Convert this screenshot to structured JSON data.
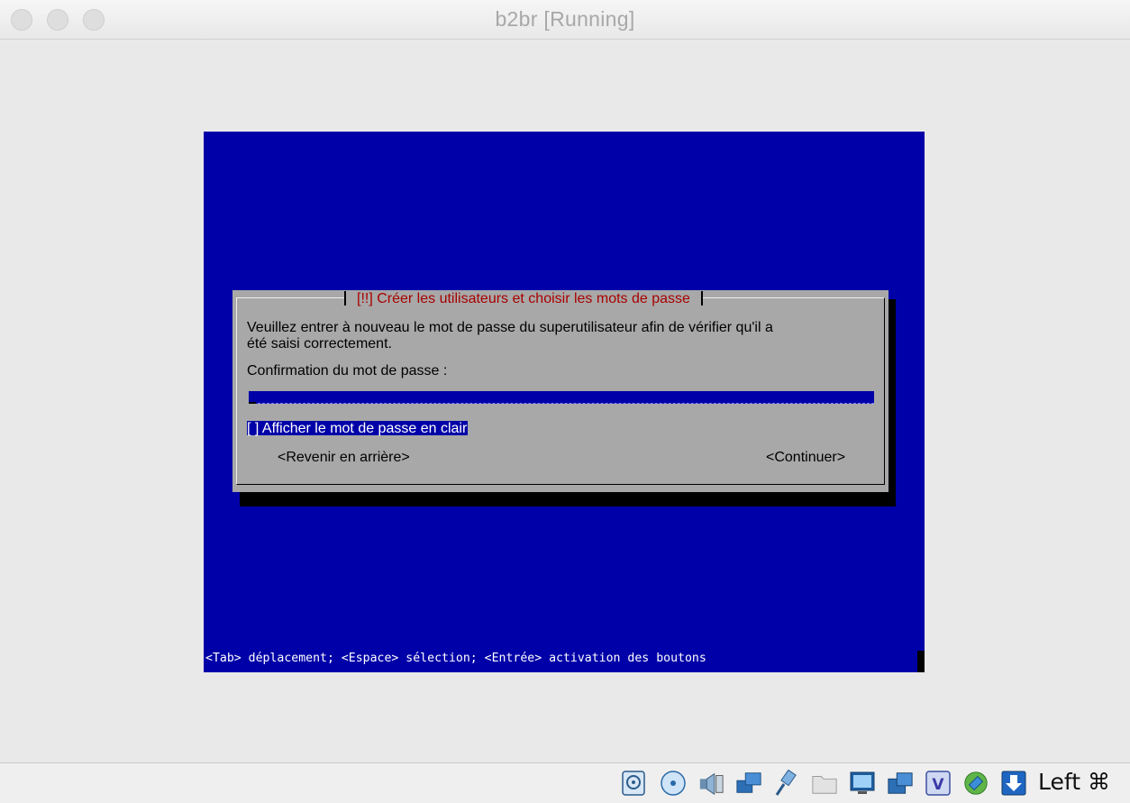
{
  "window": {
    "title": "b2br [Running]"
  },
  "dialog": {
    "title": "[!!] Créer les utilisateurs et choisir les mots de passe",
    "text_line1": "Veuillez entrer à nouveau le mot de passe du superutilisateur afin de vérifier qu'il a",
    "text_line2": "été saisi correctement.",
    "field_label": "Confirmation du mot de passe :",
    "password_value": "",
    "show_password_label": "[ ] Afficher le mot de passe en clair",
    "back_button": "<Revenir en arrière>",
    "continue_button": "<Continuer>"
  },
  "help_line": "<Tab> déplacement; <Espace> sélection; <Entrée> activation des boutons",
  "statusbar": {
    "host_key": "Left ⌘",
    "icons": [
      "hard-disk-icon",
      "optical-drive-icon",
      "audio-icon",
      "network-icon",
      "usb-icon",
      "shared-folders-icon",
      "display-icon",
      "video-capture-icon",
      "virtualbox-icon",
      "mouse-integration-icon",
      "download-icon"
    ]
  },
  "colors": {
    "screen_blue": "#0000a8",
    "dialog_gray": "#a8a8a8",
    "title_red": "#a80000"
  }
}
